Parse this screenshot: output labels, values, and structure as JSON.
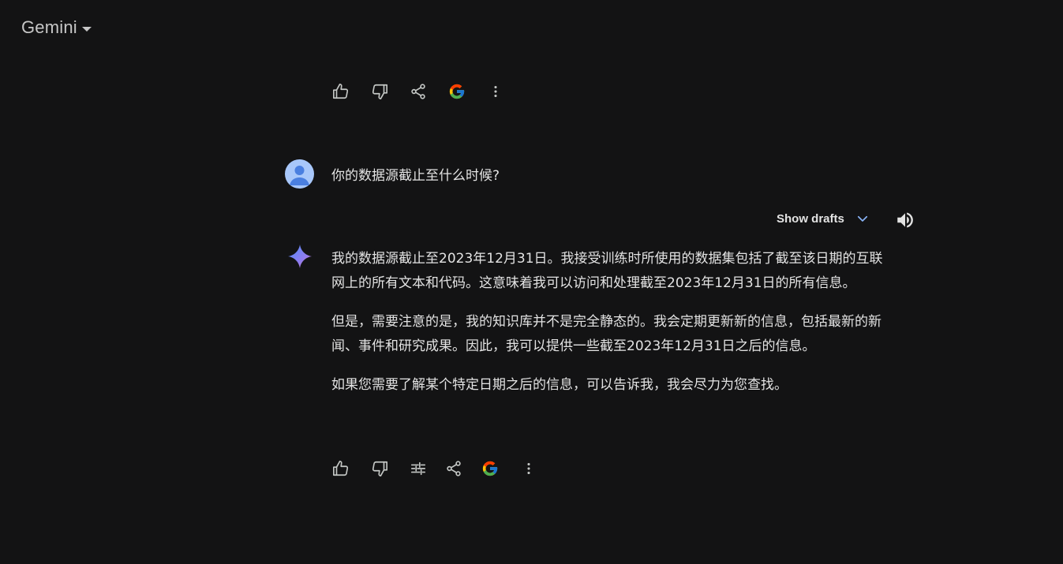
{
  "header": {
    "app_name": "Gemini"
  },
  "top_actions": {
    "items": [
      "thumb-up-icon",
      "thumb-down-icon",
      "share-icon",
      "google-g-icon",
      "more-vert-icon"
    ]
  },
  "user_turn": {
    "prompt_text": "你的数据源截止至什么时候?"
  },
  "drafts": {
    "label": "Show drafts"
  },
  "response": {
    "paragraphs": [
      "我的数据源截止至2023年12月31日。我接受训练时所使用的数据集包括了截至该日期的互联网上的所有文本和代码。这意味着我可以访问和处理截至2023年12月31日的所有信息。",
      "但是，需要注意的是，我的知识库并不是完全静态的。我会定期更新新的信息，包括最新的新闻、事件和研究成果。因此，我可以提供一些截至2023年12月31日之后的信息。",
      "如果您需要了解某个特定日期之后的信息，可以告诉我，我会尽力为您查找。"
    ]
  },
  "bottom_actions": {
    "items": [
      "thumb-up-icon",
      "thumb-down-icon",
      "tune-icon",
      "share-icon",
      "google-g-icon",
      "more-vert-icon"
    ]
  },
  "colors": {
    "background": "#131314",
    "text": "#e3e3e3",
    "icon": "#c4c7c5",
    "accent_blue": "#8ab4f8",
    "avatar": "#a8c7fa"
  }
}
